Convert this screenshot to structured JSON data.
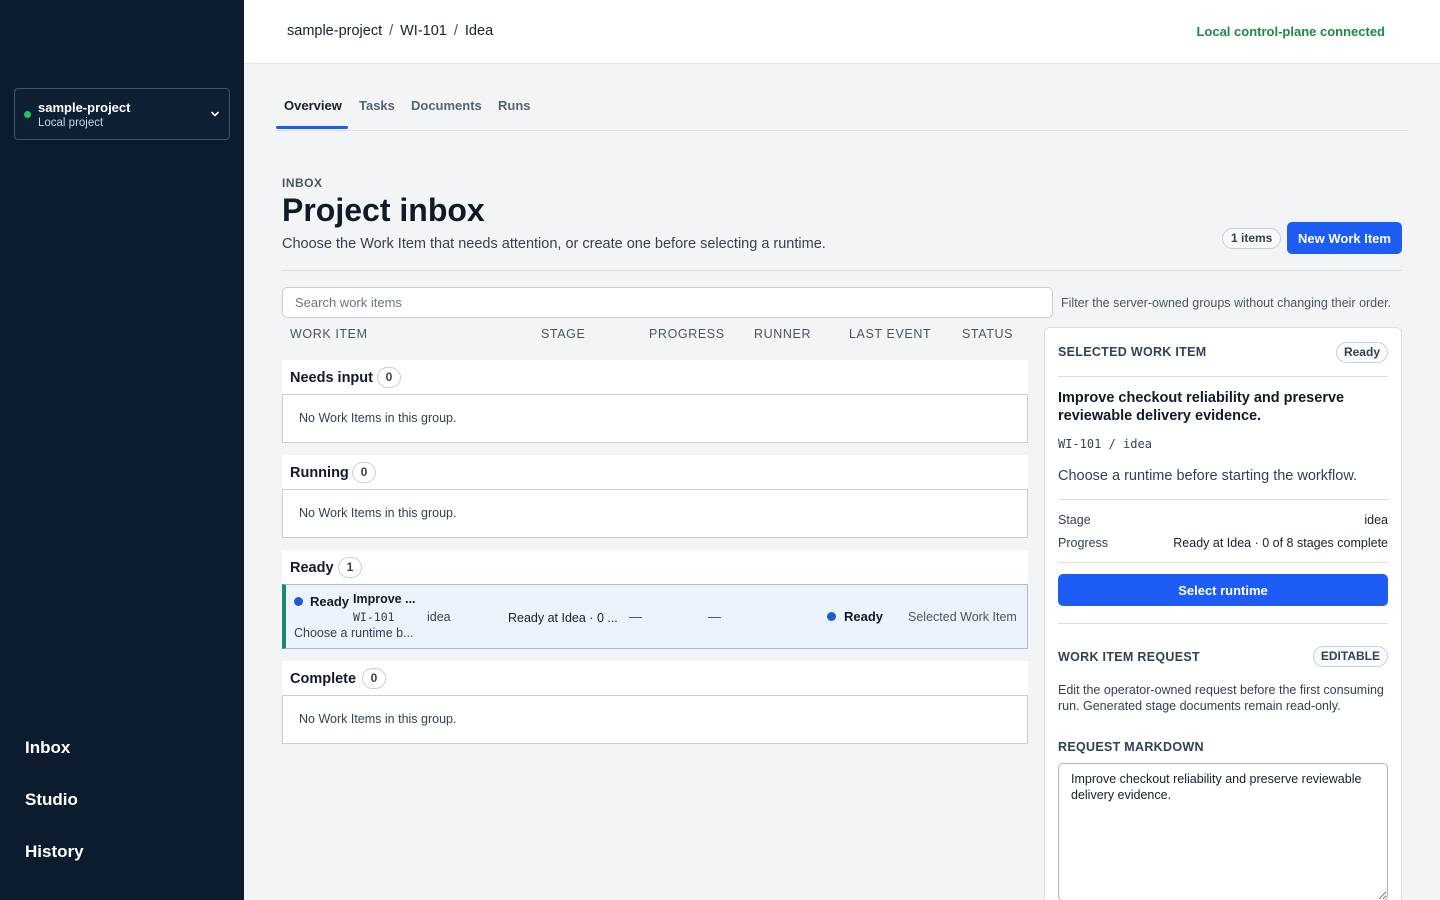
{
  "sidebar": {
    "project": {
      "name": "sample-project",
      "subtitle": "Local project"
    },
    "nav": [
      {
        "label": "Inbox"
      },
      {
        "label": "Studio"
      },
      {
        "label": "History"
      }
    ]
  },
  "topbar": {
    "breadcrumb": [
      "sample-project",
      "WI-101",
      "Idea"
    ],
    "separator": "/",
    "connection_status": "Local control-plane connected"
  },
  "tabs": [
    {
      "label": "Overview",
      "active": true
    },
    {
      "label": "Tasks",
      "active": false
    },
    {
      "label": "Documents",
      "active": false
    },
    {
      "label": "Runs",
      "active": false
    }
  ],
  "header": {
    "eyebrow": "INBOX",
    "title": "Project inbox",
    "subtitle": "Choose the Work Item that needs attention, or create one before selecting a runtime.",
    "count_badge": "1 items",
    "new_button": "New Work Item"
  },
  "search": {
    "placeholder": "Search work items",
    "value": "",
    "hint": "Filter the server-owned groups without changing their order."
  },
  "table": {
    "columns": [
      "WORK ITEM",
      "STAGE",
      "PROGRESS",
      "RUNNER",
      "LAST EVENT",
      "STATUS"
    ],
    "empty_text": "No Work Items in this group.",
    "groups": [
      {
        "name": "Needs input",
        "count": "0"
      },
      {
        "name": "Running",
        "count": "0"
      },
      {
        "name": "Ready",
        "count": "1"
      },
      {
        "name": "Complete",
        "count": "0"
      }
    ],
    "ready_row": {
      "status_label": "Ready",
      "title": "Improve ...",
      "id": "WI-101",
      "stage": "idea",
      "description": "Choose a runtime b...",
      "progress": "Ready at Idea · 0 ...",
      "runner": "—",
      "last_event": "—",
      "status": "Ready",
      "selected_label": "Selected Work Item"
    }
  },
  "panel": {
    "label": "SELECTED WORK ITEM",
    "badge": "Ready",
    "title": "Improve checkout reliability and preserve reviewable delivery evidence.",
    "id_path": "WI-101 / idea",
    "note": "Choose a runtime before starting the workflow.",
    "stage_label": "Stage",
    "stage_value": "idea",
    "progress_label": "Progress",
    "progress_value": "Ready at Idea · 0 of 8 stages complete",
    "select_button": "Select runtime",
    "request": {
      "label": "WORK ITEM REQUEST",
      "badge": "EDITABLE",
      "description": "Edit the operator-owned request before the first consuming run. Generated stage documents remain read-only.",
      "markdown_label": "REQUEST MARKDOWN",
      "markdown_value": "Improve checkout reliability and preserve reviewable delivery evidence."
    }
  },
  "colors": {
    "sidebar_bg": "#0d1b2e",
    "accent": "#1d5cf5",
    "connected": "#1d8a44",
    "ready_dot": "#1d5bd6",
    "online_dot": "#22c55e"
  },
  "icons": {
    "switcher_chevron": "chevron-down-icon",
    "status_dot": "status-dot-icon"
  }
}
